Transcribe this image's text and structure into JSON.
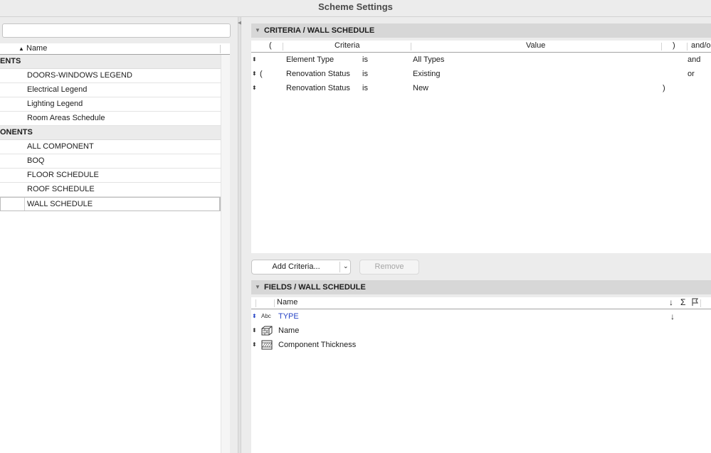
{
  "window": {
    "title": "Scheme Settings"
  },
  "left_pane": {
    "search_value": "",
    "list_header": {
      "name": "Name"
    },
    "rows": [
      {
        "kind": "group",
        "label": "ENTS"
      },
      {
        "kind": "item",
        "label": "DOORS-WINDOWS LEGEND"
      },
      {
        "kind": "item",
        "label": "Electrical Legend"
      },
      {
        "kind": "item",
        "label": "Lighting Legend"
      },
      {
        "kind": "item",
        "label": "Room Areas Schedule"
      },
      {
        "kind": "group",
        "label": "ONENTS"
      },
      {
        "kind": "item",
        "label": "ALL COMPONENT"
      },
      {
        "kind": "item",
        "label": "BOQ"
      },
      {
        "kind": "item",
        "label": "FLOOR SCHEDULE"
      },
      {
        "kind": "item",
        "label": "ROOF SCHEDULE"
      },
      {
        "kind": "item",
        "label": "WALL SCHEDULE",
        "selected": true
      }
    ]
  },
  "criteria": {
    "section_title": "CRITERIA /  WALL SCHEDULE",
    "columns": {
      "open_paren": "(",
      "criteria": "Criteria",
      "value": "Value",
      "close_paren": ")",
      "andor": "and/o"
    },
    "rows": [
      {
        "open": "",
        "criteria": "Element Type",
        "op": "is",
        "value": "All Types",
        "close": "",
        "andor": "and"
      },
      {
        "open": "(",
        "criteria": "Renovation Status",
        "op": "is",
        "value": "Existing",
        "close": "",
        "andor": "or"
      },
      {
        "open": "",
        "criteria": "Renovation Status",
        "op": "is",
        "value": "New",
        "close": ")",
        "andor": ""
      }
    ],
    "add_button": "Add Criteria...",
    "remove_button": "Remove"
  },
  "fields": {
    "section_title": "FIELDS /  WALL SCHEDULE",
    "columns": {
      "name": "Name",
      "sort": "↓",
      "sum": "Σ"
    },
    "rows": [
      {
        "icon": "abc-text-icon",
        "icon_text": "Abc",
        "name": "TYPE",
        "sort": "↓",
        "link": true
      },
      {
        "icon": "wall-object-icon",
        "name": "Name",
        "sort": ""
      },
      {
        "icon": "hatch-thickness-icon",
        "name": "Component Thickness",
        "sort": ""
      }
    ]
  }
}
